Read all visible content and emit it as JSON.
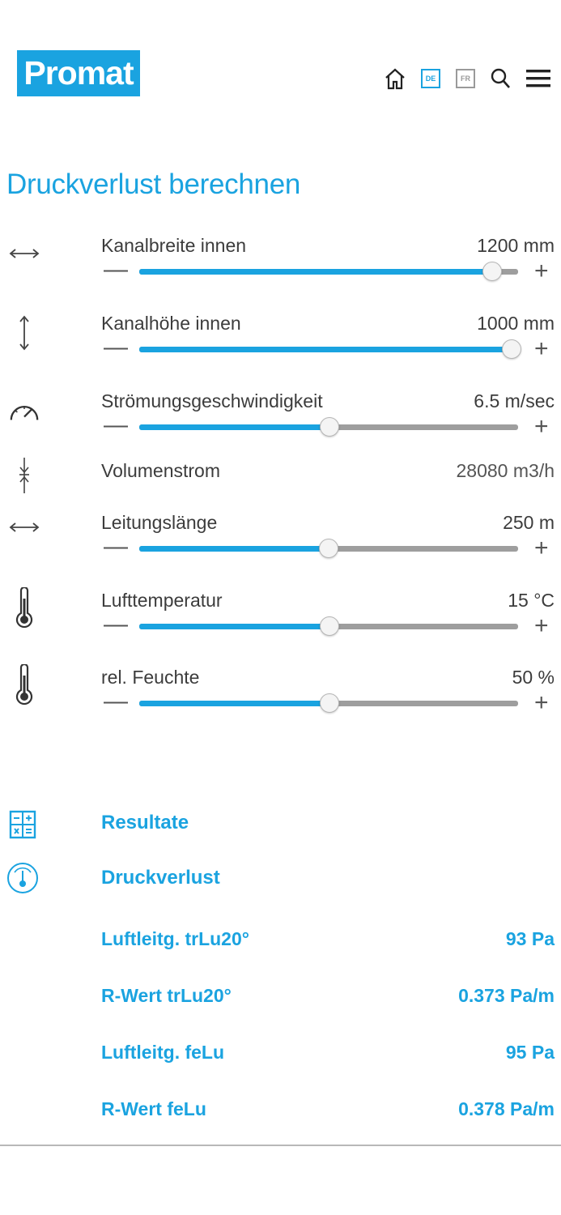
{
  "header": {
    "logo": "Promat",
    "lang_de": "DE",
    "lang_fr": "FR",
    "icons": [
      "home-icon",
      "search-icon",
      "menu-icon"
    ]
  },
  "page_title": "Druckverlust berechnen",
  "inputs": [
    {
      "icon": "width-arrows-icon",
      "label": "Kanalbreite innen",
      "value": "1200 mm",
      "slider_fraction": 0.93
    },
    {
      "icon": "height-arrows-icon",
      "label": "Kanalhöhe innen",
      "value": "1000 mm",
      "slider_fraction": 0.98
    },
    {
      "icon": "speedometer-icon",
      "label": "Strömungsgeschwindigkeit",
      "value": "6.5 m/sec",
      "slider_fraction": 0.5
    },
    {
      "icon": "flow-arrows-icon",
      "label": "Volumenstrom",
      "value": "28080 m3/h"
    },
    {
      "icon": "length-arrows-icon",
      "label": "Leitungslänge",
      "value": "250 m",
      "slider_fraction": 0.497
    },
    {
      "icon": "thermometer-icon",
      "label": "Lufttemperatur",
      "value": "15 °C",
      "slider_fraction": 0.5
    },
    {
      "icon": "thermometer-icon",
      "label": "rel. Feuchte",
      "value": "50 %",
      "slider_fraction": 0.5
    }
  ],
  "minus_symbol": "—",
  "plus_symbol": "+",
  "results": {
    "heading": "Resultate",
    "subheading": "Druckverlust",
    "rows": [
      {
        "label": "Luftleitg. trLu20°",
        "value": "93 Pa"
      },
      {
        "label": "R-Wert trLu20°",
        "value": "0.373 Pa/m"
      },
      {
        "label": "Luftleitg. feLu",
        "value": "95 Pa"
      },
      {
        "label": "R-Wert feLu",
        "value": "0.378 Pa/m"
      }
    ]
  },
  "colors": {
    "accent": "#1aa3e0",
    "track": "#9e9e9e",
    "text": "#3c3c3c"
  }
}
